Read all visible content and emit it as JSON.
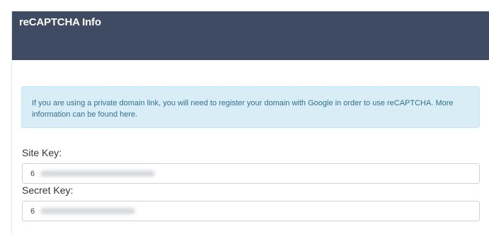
{
  "panel": {
    "title": "reCAPTCHA Info"
  },
  "info": {
    "message": "If you are using a private domain link, you will need to register your domain with Google in order to use reCAPTCHA. More information can be found here."
  },
  "site_key": {
    "label": "Site Key:",
    "value": "6"
  },
  "secret_key": {
    "label": "Secret Key:",
    "value": "6"
  },
  "colors": {
    "header": "#3f4b63",
    "info_background": "#d9edf7",
    "info_text": "#31708f"
  }
}
